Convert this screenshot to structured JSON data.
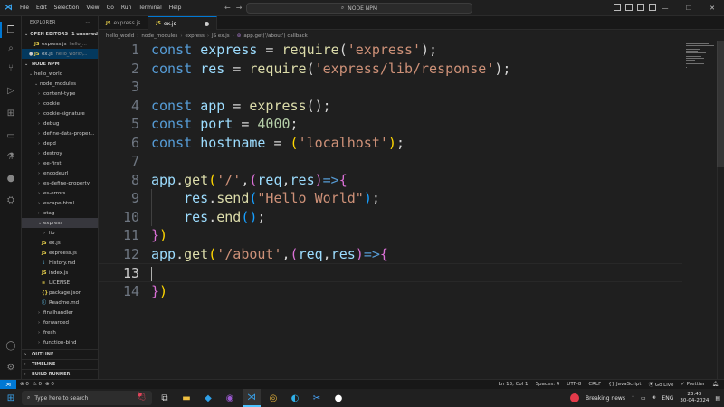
{
  "titlebar": {
    "menu": [
      "File",
      "Edit",
      "Selection",
      "View",
      "Go",
      "Run",
      "Terminal",
      "Help"
    ],
    "search_text": "NODE NPM"
  },
  "sidebar": {
    "title": "EXPLORER",
    "open_editors": {
      "label": "OPEN EDITORS",
      "badge": "1 unsaved"
    },
    "open_files": [
      {
        "icon": "JS",
        "name": "express.js",
        "desc": "hello_..."
      },
      {
        "icon": "JS",
        "name": "ex.js",
        "desc": "hello_world\\..."
      }
    ],
    "workspace": "NODE NPM",
    "project": "hello_world",
    "node_modules": "node_modules",
    "modules": [
      "content-type",
      "cookie",
      "cookie-signature",
      "debug",
      "define-data-proper...",
      "depd",
      "destroy",
      "ee-first",
      "encodeurl",
      "es-define-property",
      "es-errors",
      "escape-html",
      "etag"
    ],
    "express_folder": "express",
    "lib_folder": "lib",
    "express_files": [
      {
        "icon": "JS",
        "name": "ex.js",
        "type": "js"
      },
      {
        "icon": "JS",
        "name": "expreess.js",
        "type": "js"
      },
      {
        "icon": "↓",
        "name": "History.md",
        "type": "md"
      },
      {
        "icon": "JS",
        "name": "index.js",
        "type": "js"
      },
      {
        "icon": "≡",
        "name": "LICENSE",
        "type": "lic"
      },
      {
        "icon": "{}",
        "name": "package.json",
        "type": "json"
      },
      {
        "icon": "ⓘ",
        "name": "Readme.md",
        "type": "md"
      }
    ],
    "more_modules": [
      "finalhandler",
      "forwarded",
      "fresh",
      "function-bind"
    ],
    "bottom_sections": [
      "OUTLINE",
      "TIMELINE",
      "BUILD RUNNER"
    ]
  },
  "tabs": [
    {
      "icon": "JS",
      "label": "express.js",
      "active": false
    },
    {
      "icon": "JS",
      "label": "ex.js",
      "active": true
    }
  ],
  "breadcrumb": [
    "hello_world",
    "node_modules",
    "express",
    "JS ex.js",
    "app.get('/about') callback"
  ],
  "editor": {
    "lines": [
      {
        "n": "1",
        "tokens": [
          [
            "kw",
            "const "
          ],
          [
            "var",
            "express"
          ],
          [
            "pn",
            " = "
          ],
          [
            "fn",
            "require"
          ],
          [
            "pn",
            "("
          ],
          [
            "str",
            "'express'"
          ],
          [
            "pn",
            ");"
          ]
        ]
      },
      {
        "n": "2",
        "tokens": [
          [
            "kw",
            "const "
          ],
          [
            "var",
            "res"
          ],
          [
            "pn",
            " = "
          ],
          [
            "fn",
            "require"
          ],
          [
            "pn",
            "("
          ],
          [
            "str",
            "'express/lib/response'"
          ],
          [
            "pn",
            ");"
          ]
        ]
      },
      {
        "n": "3",
        "tokens": []
      },
      {
        "n": "4",
        "tokens": [
          [
            "kw",
            "const "
          ],
          [
            "var",
            "app"
          ],
          [
            "pn",
            " = "
          ],
          [
            "fn",
            "express"
          ],
          [
            "pn",
            "();"
          ]
        ]
      },
      {
        "n": "5",
        "tokens": [
          [
            "kw",
            "const "
          ],
          [
            "var",
            "port"
          ],
          [
            "pn",
            " = "
          ],
          [
            "num",
            "4000"
          ],
          [
            "pn",
            ";"
          ]
        ]
      },
      {
        "n": "6",
        "tokens": [
          [
            "kw",
            "const "
          ],
          [
            "var",
            "hostname"
          ],
          [
            "pn",
            " = "
          ],
          [
            "br1",
            "("
          ],
          [
            "str",
            "'localhost'"
          ],
          [
            "br1",
            ")"
          ],
          [
            "pn",
            ";"
          ]
        ]
      },
      {
        "n": "7",
        "tokens": []
      },
      {
        "n": "8",
        "tokens": [
          [
            "var",
            "app"
          ],
          [
            "pn",
            "."
          ],
          [
            "fn",
            "get"
          ],
          [
            "br1",
            "("
          ],
          [
            "str",
            "'/'"
          ],
          [
            "pn",
            ","
          ],
          [
            "br2",
            "("
          ],
          [
            "var",
            "req"
          ],
          [
            "pn",
            ","
          ],
          [
            "var",
            "res"
          ],
          [
            "br2",
            ")"
          ],
          [
            "kw",
            "=>"
          ],
          [
            "br2",
            "{"
          ]
        ]
      },
      {
        "n": "9",
        "tokens": [
          [
            "pn",
            "    "
          ],
          [
            "var",
            "res"
          ],
          [
            "pn",
            "."
          ],
          [
            "fn",
            "send"
          ],
          [
            "br3",
            "("
          ],
          [
            "str",
            "\"Hello World\""
          ],
          [
            "br3",
            ")"
          ],
          [
            "pn",
            ";"
          ]
        ]
      },
      {
        "n": "10",
        "tokens": [
          [
            "pn",
            "    "
          ],
          [
            "var",
            "res"
          ],
          [
            "pn",
            "."
          ],
          [
            "fn",
            "end"
          ],
          [
            "br3",
            "()"
          ],
          [
            "pn",
            ";"
          ]
        ]
      },
      {
        "n": "11",
        "tokens": [
          [
            "br2",
            "}"
          ],
          [
            "br1",
            ")"
          ]
        ]
      },
      {
        "n": "12",
        "tokens": [
          [
            "var",
            "app"
          ],
          [
            "pn",
            "."
          ],
          [
            "fn",
            "get"
          ],
          [
            "br1",
            "("
          ],
          [
            "str",
            "'/about'"
          ],
          [
            "pn",
            ","
          ],
          [
            "br2",
            "("
          ],
          [
            "var",
            "req"
          ],
          [
            "pn",
            ","
          ],
          [
            "var",
            "res"
          ],
          [
            "br2",
            ")"
          ],
          [
            "kw",
            "=>"
          ],
          [
            "br2",
            "{"
          ]
        ]
      },
      {
        "n": "13",
        "tokens": [],
        "current": true
      },
      {
        "n": "14",
        "tokens": [
          [
            "br2",
            "}"
          ],
          [
            "br1",
            ")"
          ]
        ]
      }
    ]
  },
  "statusbar": {
    "left": [
      "⊗ 0",
      "⚠ 0",
      "⊕ 0"
    ],
    "right": [
      "Ln 13, Col 1",
      "Spaces: 4",
      "UTF-8",
      "CRLF",
      "{} JavaScript",
      "⦿ Go Live",
      "✓ Prettier"
    ]
  },
  "taskbar": {
    "search_placeholder": "Type here to search",
    "news": "Breaking news",
    "lang": "ENG",
    "time": "23:43",
    "date": "30-04-2024"
  }
}
